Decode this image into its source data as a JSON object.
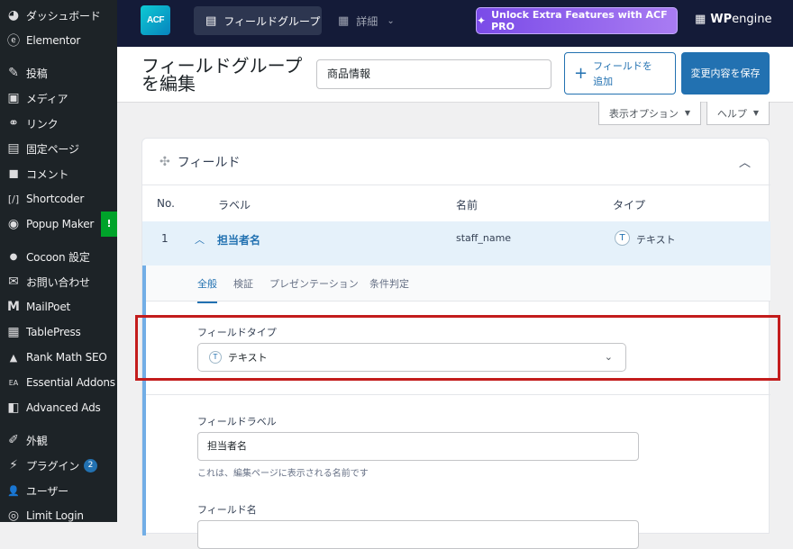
{
  "sidebar": {
    "items": [
      {
        "icon": "dashboard-icon",
        "glyph": "◕",
        "label": "ダッシュボード"
      },
      {
        "icon": "elementor-icon",
        "glyph": "ⓔ",
        "label": "Elementor"
      },
      {
        "icon": "pin-icon",
        "glyph": "✎",
        "label": "投稿"
      },
      {
        "icon": "media-icon",
        "glyph": "▣",
        "label": "メディア"
      },
      {
        "icon": "link-icon",
        "glyph": "⚭",
        "label": "リンク"
      },
      {
        "icon": "page-icon",
        "glyph": "▤",
        "label": "固定ページ"
      },
      {
        "icon": "comment-icon",
        "glyph": "◼",
        "label": "コメント"
      },
      {
        "icon": "shortcoder-icon",
        "glyph": "[/]",
        "label": "Shortcoder"
      },
      {
        "icon": "popup-maker-icon",
        "glyph": "◉",
        "label": "Popup Maker",
        "badge": "!"
      },
      {
        "icon": "cocoon-icon",
        "glyph": "●",
        "label": "Cocoon 設定"
      },
      {
        "icon": "mail-icon",
        "glyph": "✉",
        "label": "お問い合わせ"
      },
      {
        "icon": "mailpoet-icon",
        "glyph": "M",
        "label": "MailPoet"
      },
      {
        "icon": "tablepress-icon",
        "glyph": "▦",
        "label": "TablePress"
      },
      {
        "icon": "rank-math-icon",
        "glyph": "▲",
        "label": "Rank Math SEO"
      },
      {
        "icon": "essential-addons-icon",
        "glyph": "EA",
        "label": "Essential Addons"
      },
      {
        "icon": "advanced-ads-icon",
        "glyph": "◧",
        "label": "Advanced Ads"
      },
      {
        "icon": "appearance-icon",
        "glyph": "✐",
        "label": "外観"
      },
      {
        "icon": "plugin-icon",
        "glyph": "⚡",
        "label": "プラグイン",
        "count": "2"
      },
      {
        "icon": "user-icon",
        "glyph": "👤",
        "label": "ユーザー"
      },
      {
        "icon": "limit-login-icon",
        "glyph": "◎",
        "label": "Limit Login"
      }
    ]
  },
  "topbar": {
    "logo": "ACF",
    "tab_field_groups": "フィールドグループ",
    "tab_details": "詳細",
    "unlock_label": "Unlock Extra Features with ACF PRO",
    "wpengine_wp": "WP",
    "wpengine_engine": "engine"
  },
  "header": {
    "title": "フィールドグループを編集",
    "group_name_value": "商品情報",
    "add_field_label": "フィールドを追加",
    "save_label": "変更内容を保存"
  },
  "screen_options": {
    "display_label": "表示オプション",
    "help_label": "ヘルプ"
  },
  "fields_panel": {
    "title": "フィールド",
    "columns": {
      "no": "No.",
      "label": "ラベル",
      "name": "名前",
      "type": "タイプ"
    },
    "row": {
      "order": "1",
      "label": "担当者名",
      "name": "staff_name",
      "type_icon": "T",
      "type": "テキスト"
    },
    "subtabs": [
      "全般",
      "検証",
      "プレゼンテーション",
      "条件判定"
    ],
    "field_type_label": "フィールドタイプ",
    "field_type_value": "テキスト",
    "field_type_icon": "T",
    "field_label_label": "フィールドラベル",
    "field_label_value": "担当者名",
    "field_label_hint": "これは、編集ページに表示される名前です",
    "field_name_label": "フィールド名"
  },
  "colors": {
    "highlight": "#c31c1c",
    "accent": "#2271b1",
    "unlock": "#7a4be8"
  }
}
